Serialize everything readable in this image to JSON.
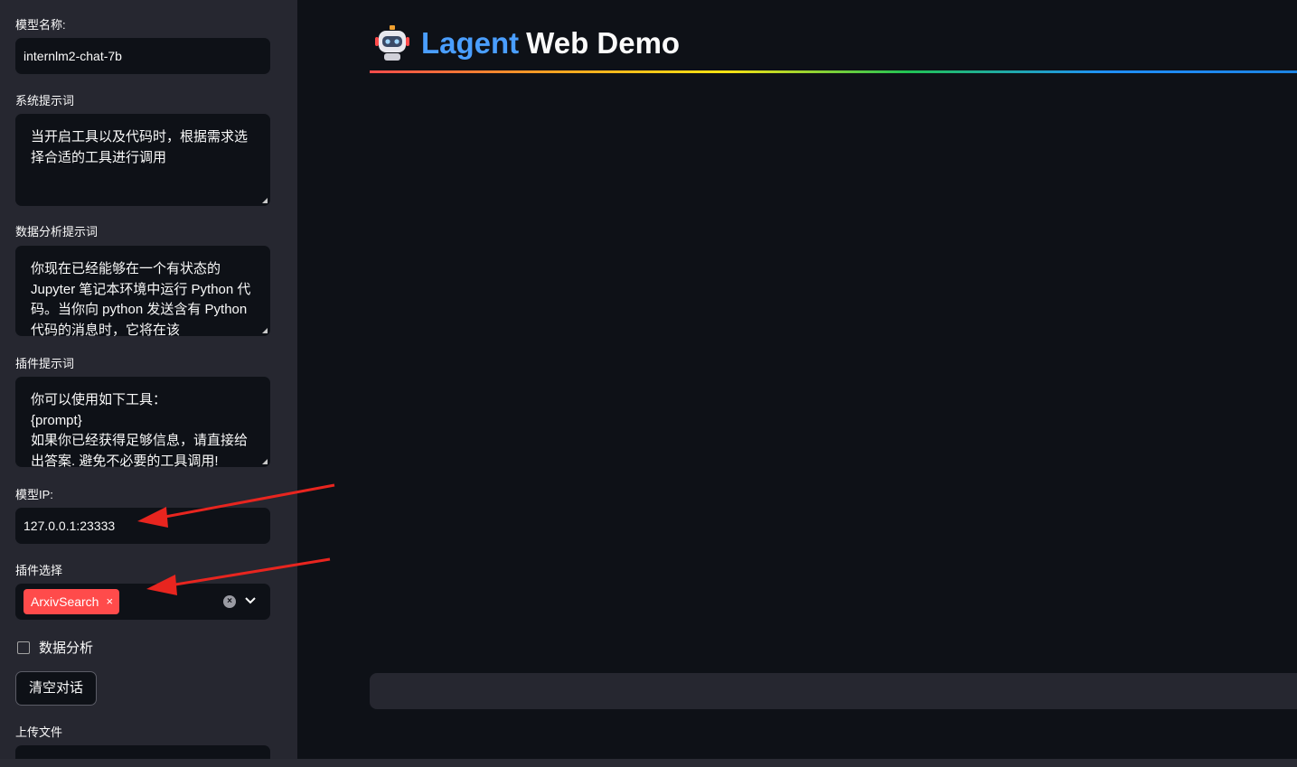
{
  "sidebar": {
    "model_name_label": "模型名称:",
    "model_name_value": "internlm2-chat-7b",
    "system_prompt_label": "系统提示词",
    "system_prompt_value": "当开启工具以及代码时，根据需求选择合适的工具进行调用",
    "data_prompt_label": "数据分析提示词",
    "data_prompt_value": "你现在已经能够在一个有状态的 Jupyter 笔记本环境中运行 Python 代码。当你向 python 发送含有 Python 代码的消息时，它将在该",
    "plugin_prompt_label": "插件提示词",
    "plugin_prompt_value": "你可以使用如下工具：\n{prompt}\n如果你已经获得足够信息，请直接给出答案. 避免不必要的工具调用!",
    "model_ip_label": "模型IP:",
    "model_ip_value": "127.0.0.1:23333",
    "plugin_select_label": "插件选择",
    "plugin_selected": "ArxivSearch",
    "plugin_remove_glyph": "×",
    "data_analysis_label": "数据分析",
    "clear_button_label": "清空对话",
    "upload_label": "上传文件"
  },
  "main": {
    "title_part1": "Lagent",
    "title_part2": "Web Demo",
    "robot_icon": "robot-icon"
  },
  "colors": {
    "accent": "#ff4b4b",
    "title_blue": "#4a9eff",
    "bg": "#0e1117",
    "sidebar_bg": "#262730",
    "annotation_arrow": "#e8251f"
  }
}
